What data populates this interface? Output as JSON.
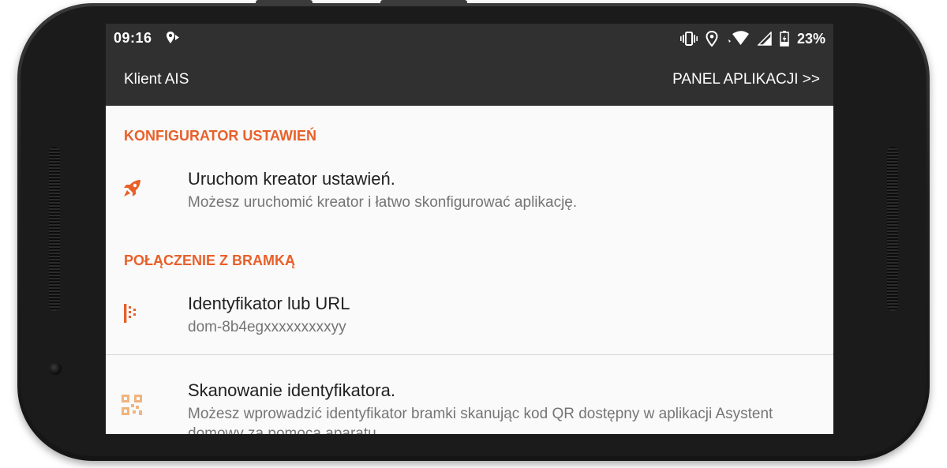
{
  "status_bar": {
    "time": "09:16",
    "battery_percent": "23%",
    "icons": [
      "location-arrow-icon",
      "vibrate-icon",
      "location-icon",
      "wifi-icon",
      "cell-signal-icon",
      "battery-charging-icon"
    ]
  },
  "app_bar": {
    "title": "Klient AIS",
    "action_label": "PANEL APLIKACJI >>"
  },
  "sections": [
    {
      "header": "KONFIGURATOR USTAWIEŃ",
      "items": [
        {
          "icon": "rocket-icon",
          "title": "Uruchom kreator ustawień.",
          "summary": "Możesz uruchomić kreator i łatwo skonfigurować aplikację."
        }
      ]
    },
    {
      "header": "POŁĄCZENIE Z BRAMKĄ",
      "items": [
        {
          "icon": "identifier-icon",
          "title": "Identyfikator lub URL",
          "summary": "dom-8b4egxxxxxxxxxyy"
        },
        {
          "icon": "qr-code-icon",
          "title": "Skanowanie identyfikatora.",
          "summary": "Możesz wprowadzić identyfikator bramki skanując kod QR dostępny w aplikacji Asystent domowy za pomocą aparatu."
        }
      ]
    }
  ],
  "colors": {
    "accent": "#e8602a",
    "app_bar": "#303030",
    "background": "#fafafa"
  }
}
